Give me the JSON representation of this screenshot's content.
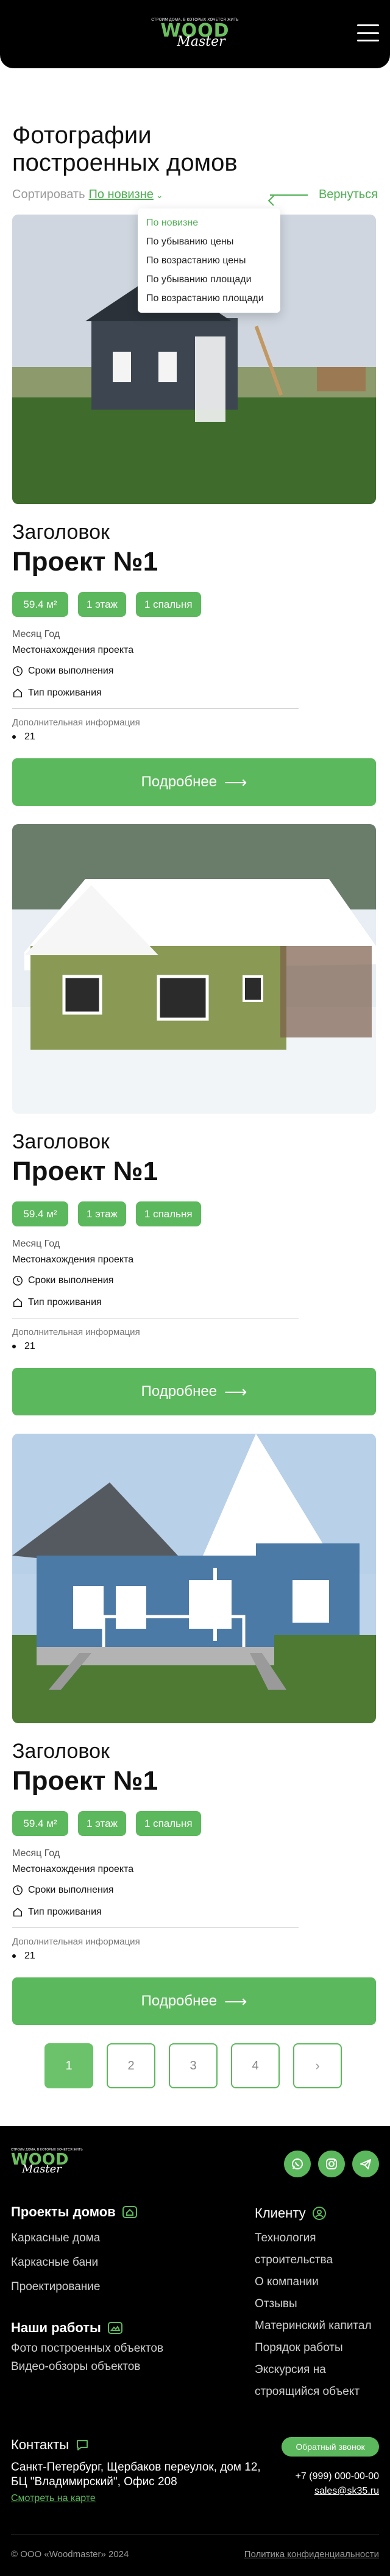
{
  "header": {
    "logo_tagline": "СТРОИМ ДОМА, В КОТОРЫХ ХОЧЕТСЯ ЖИТЬ",
    "logo_wood": "WOOD",
    "logo_master": "Master"
  },
  "page": {
    "title": "Фотографии построенных домов",
    "sort_label": "Сортировать",
    "sort_value": "По новизне",
    "back_label": "Вернуться",
    "sort_options": [
      "По новизне",
      "По убыванию цены",
      "По возрастанию цены",
      "По убыванию площади",
      "По возрастанию площади"
    ]
  },
  "projects": [
    {
      "eyebrow": "Заголовок",
      "title": "Проект №1",
      "area": "59.4 м²",
      "floors": "1 этаж",
      "bedrooms": "1 спальня",
      "date": "Месяц Год",
      "location": "Местонахождения проекта",
      "term": "Сроки выполнения",
      "living": "Тип проживания",
      "extra_label": "Дополнительная информация",
      "extra_item": "21",
      "button": "Подробнее"
    },
    {
      "eyebrow": "Заголовок",
      "title": "Проект №1",
      "area": "59.4 м²",
      "floors": "1 этаж",
      "bedrooms": "1 спальня",
      "date": "Месяц Год",
      "location": "Местонахождения проекта",
      "term": "Сроки выполнения",
      "living": "Тип проживания",
      "extra_label": "Дополнительная информация",
      "extra_item": "21",
      "button": "Подробнее"
    },
    {
      "eyebrow": "Заголовок",
      "title": "Проект №1",
      "area": "59.4 м²",
      "floors": "1 этаж",
      "bedrooms": "1 спальня",
      "date": "Месяц Год",
      "location": "Местонахождения проекта",
      "term": "Сроки выполнения",
      "living": "Тип проживания",
      "extra_label": "Дополнительная информация",
      "extra_item": "21",
      "button": "Подробнее"
    }
  ],
  "pagination": {
    "pages": [
      "1",
      "2",
      "3",
      "4"
    ],
    "current": "1"
  },
  "footer": {
    "logo_tagline": "СТРОИМ ДОМА, В КОТОРЫХ ХОЧЕТСЯ ЖИТЬ",
    "logo_wood": "WOOD",
    "logo_master": "Master",
    "projects_heading": "Проекты домов",
    "projects_links": [
      "Каркасные дома",
      "Каркасные бани",
      "Проектирование"
    ],
    "works_heading": "Наши работы",
    "works_links": [
      "Фото построенных объектов",
      "Видео-обзоры объектов"
    ],
    "client_heading": "Клиенту",
    "client_links": [
      "Технология строительства",
      "О компании",
      "Отзывы",
      "Материнский капитал",
      "Порядок работы",
      "Экскурсия на строящийся объект"
    ],
    "contacts_heading": "Контакты",
    "address": "Санкт-Петербург, Щербаков переулок, дом 12, БЦ \"Владимирский\", Офис 208",
    "map_link": "Смотреть на карте",
    "callback": "Обратный звонок",
    "phone": "+7 (999) 000-00-00",
    "email": "sales@sk35.ru",
    "copyright": "© ООО «Woodmaster» 2024",
    "policy": "Политика конфиденциальности"
  },
  "colors": {
    "accent": "#5cb85c",
    "header_bg": "#000000",
    "footer_bg": "#000000"
  }
}
